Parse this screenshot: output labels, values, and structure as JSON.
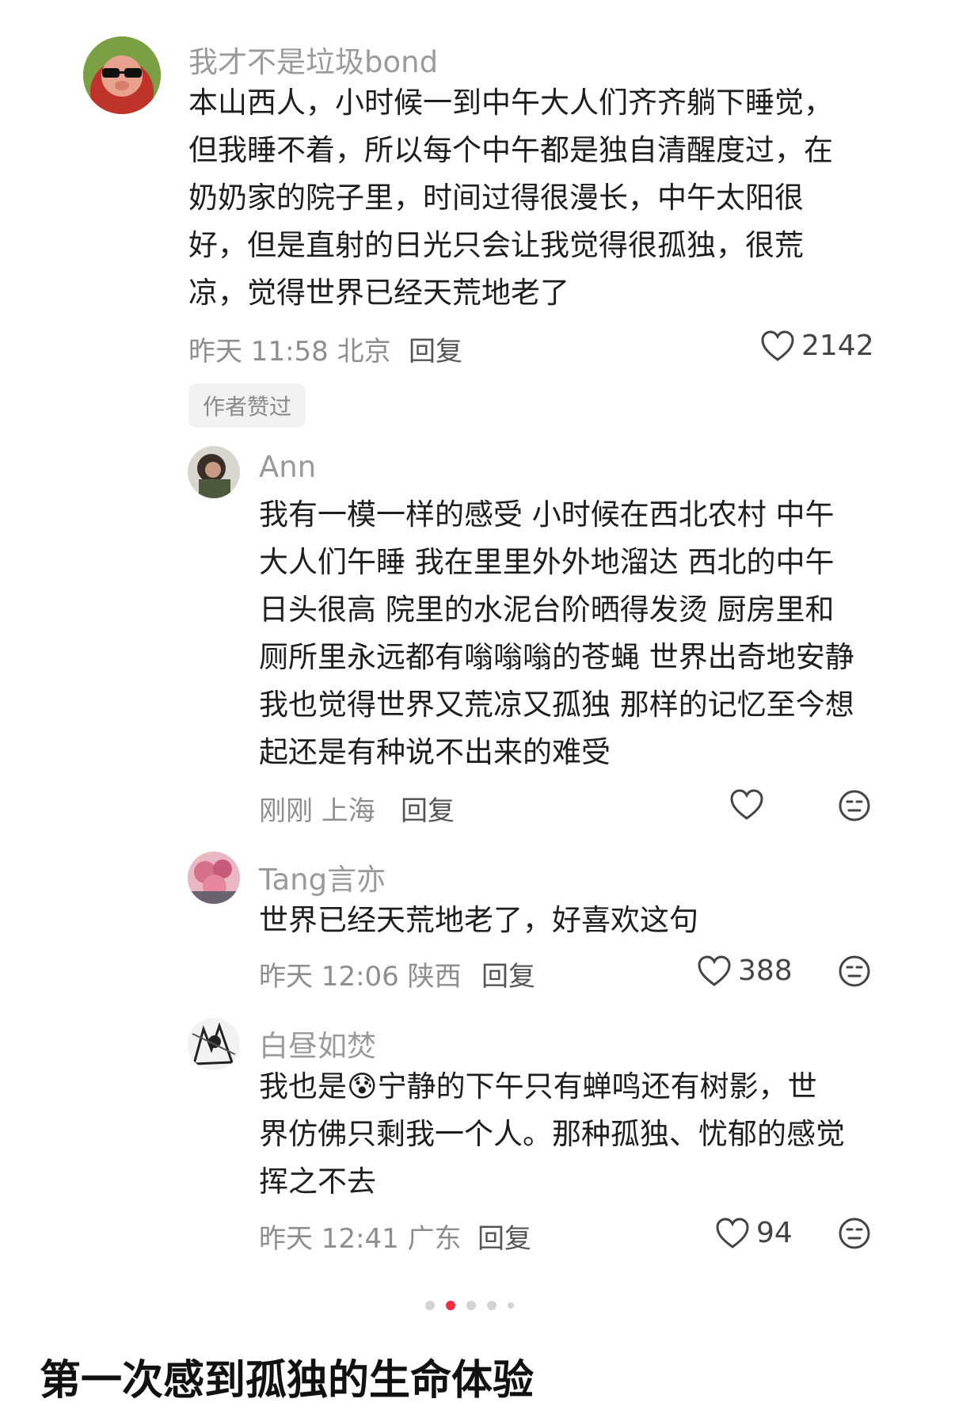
{
  "comments": [
    {
      "user": "我才不是垃圾bond",
      "lines": [
        "本山西人，小时候一到中午大人们齐齐躺下睡觉，",
        "但我睡不着，所以每个中午都是独自清醒度过，在",
        "奶奶家的院子里，时间过得很漫长，中午太阳很",
        "好，但是直射的日光只会让我觉得很孤独，很荒",
        "凉，觉得世界已经天荒地老了"
      ],
      "meta": "昨天 11:58 北京",
      "reply": "回复",
      "likes": "2142",
      "badge": "作者赞过"
    },
    {
      "user": "Ann",
      "lines": [
        "我有一模一样的感受 小时候在西北农村 中午",
        "大人们午睡 我在里里外外地溜达 西北的中午",
        "日头很高 院里的水泥台阶晒得发烫 厨房里和",
        "厕所里永远都有嗡嗡嗡的苍蝇 世界出奇地安静",
        "我也觉得世界又荒凉又孤独 那样的记忆至今想",
        "起还是有种说不出来的难受"
      ],
      "meta": "刚刚 上海",
      "reply": "回复"
    },
    {
      "user": "Tang言亦",
      "lines": [
        "世界已经天荒地老了，好喜欢这句"
      ],
      "meta": "昨天 12:06 陕西",
      "reply": "回复",
      "likes": "388"
    },
    {
      "user": "白昼如焚",
      "lines": [
        "我也是😰宁静的下午只有蝉鸣还有树影，世",
        "界仿佛只剩我一个人。那种孤独、忧郁的感觉",
        "挥之不去"
      ],
      "meta": "昨天 12:41 广东",
      "reply": "回复",
      "likes": "94"
    }
  ],
  "icons": {
    "like": "heart-outline-icon",
    "dislike": "meh-face-icon"
  },
  "pagination": {
    "total": 5,
    "active": 2
  },
  "caption": "第一次感到孤独的生命体验",
  "colors": {
    "accent": "#ef2d43",
    "meta": "#8e8e8e",
    "name": "#9a9a9a"
  }
}
